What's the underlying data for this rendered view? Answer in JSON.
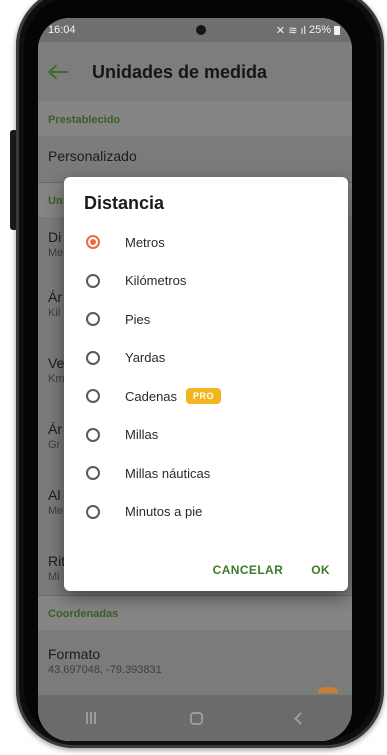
{
  "status_bar": {
    "time": "16:04",
    "icons": "✕ ≋ ıl",
    "battery": "25%"
  },
  "app_bar": {
    "title": "Unidades de medida",
    "back_icon": "arrow-left-icon"
  },
  "settings": {
    "section_preset": "Prestablecido",
    "preset_value": "Personalizado",
    "section_units": "Un",
    "rows": [
      {
        "title": "Di",
        "sub": "Me"
      },
      {
        "title": "Ár",
        "sub": "Kil"
      },
      {
        "title": "Ve",
        "sub": "Km"
      },
      {
        "title": "Ár",
        "sub": "Gr"
      },
      {
        "title": "Al",
        "sub": "Me"
      },
      {
        "title": "Rit",
        "sub": "Mi"
      }
    ],
    "section_coords": "Coordenadas",
    "format_title": "Formato",
    "format_value": "43.697048, -79.393831"
  },
  "dialog": {
    "title": "Distancia",
    "options": [
      {
        "label": "Metros",
        "checked": true
      },
      {
        "label": "Kilómetros",
        "checked": false
      },
      {
        "label": "Pies",
        "checked": false
      },
      {
        "label": "Yardas",
        "checked": false
      },
      {
        "label": "Cadenas",
        "checked": false,
        "badge": "PRO"
      },
      {
        "label": "Millas",
        "checked": false
      },
      {
        "label": "Millas náuticas",
        "checked": false
      },
      {
        "label": "Minutos a pie",
        "checked": false
      }
    ],
    "cancel_label": "CANCELAR",
    "ok_label": "OK"
  },
  "colors": {
    "accent_green": "#3d7a2a",
    "radio_selected": "#ef6a3d",
    "pro_badge": "#f2b51f"
  }
}
